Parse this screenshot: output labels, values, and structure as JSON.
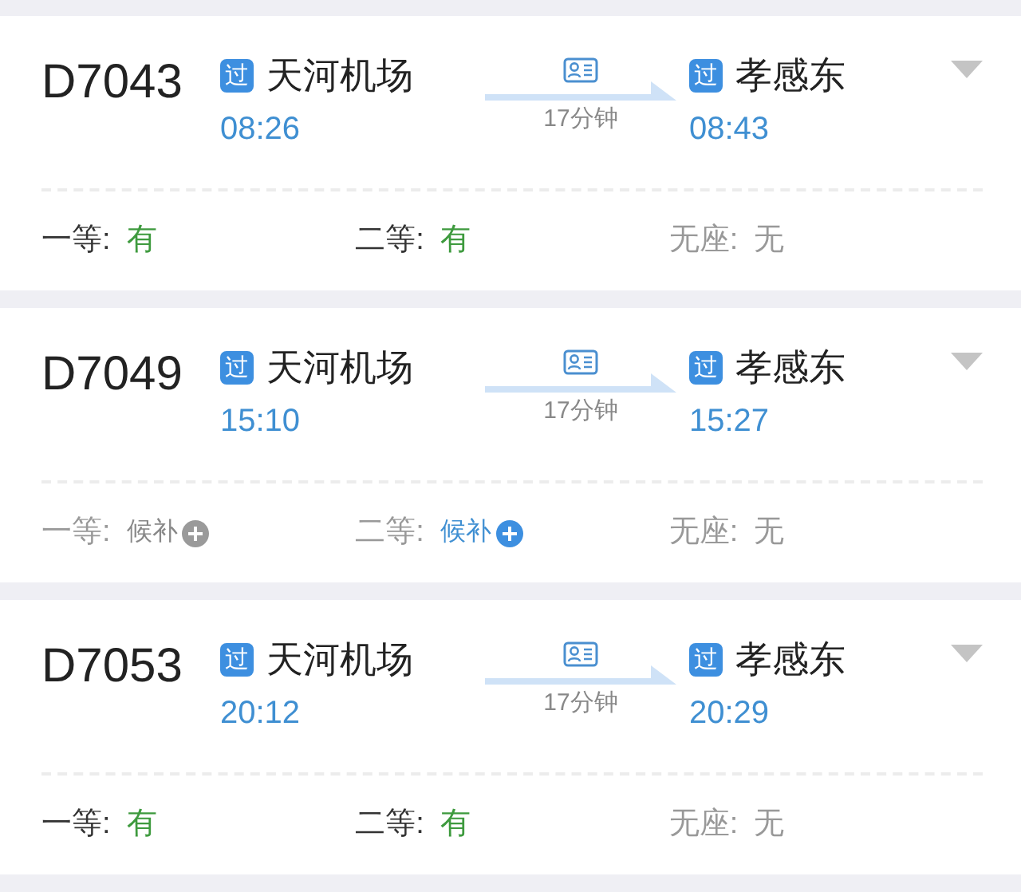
{
  "trains": [
    {
      "number": "D7043",
      "from": {
        "badge": "过",
        "station": "天河机场",
        "time": "08:26"
      },
      "duration": "17分钟",
      "to": {
        "badge": "过",
        "station": "孝感东",
        "time": "08:43"
      },
      "seats": [
        {
          "label": "一等:",
          "value": "有",
          "kind": "available"
        },
        {
          "label": "二等:",
          "value": "有",
          "kind": "available"
        },
        {
          "label": "无座:",
          "value": "无",
          "kind": "sold_out"
        }
      ]
    },
    {
      "number": "D7049",
      "from": {
        "badge": "过",
        "station": "天河机场",
        "time": "15:10"
      },
      "duration": "17分钟",
      "to": {
        "badge": "过",
        "station": "孝感东",
        "time": "15:27"
      },
      "seats": [
        {
          "label": "一等:",
          "value": "候补",
          "kind": "waitlist"
        },
        {
          "label": "二等:",
          "value": "候补",
          "kind": "waitlist_open"
        },
        {
          "label": "无座:",
          "value": "无",
          "kind": "sold_out"
        }
      ]
    },
    {
      "number": "D7053",
      "from": {
        "badge": "过",
        "station": "天河机场",
        "time": "20:12"
      },
      "duration": "17分钟",
      "to": {
        "badge": "过",
        "station": "孝感东",
        "time": "20:29"
      },
      "seats": [
        {
          "label": "一等:",
          "value": "有",
          "kind": "available"
        },
        {
          "label": "二等:",
          "value": "有",
          "kind": "available"
        },
        {
          "label": "无座:",
          "value": "无",
          "kind": "sold_out"
        }
      ]
    }
  ]
}
